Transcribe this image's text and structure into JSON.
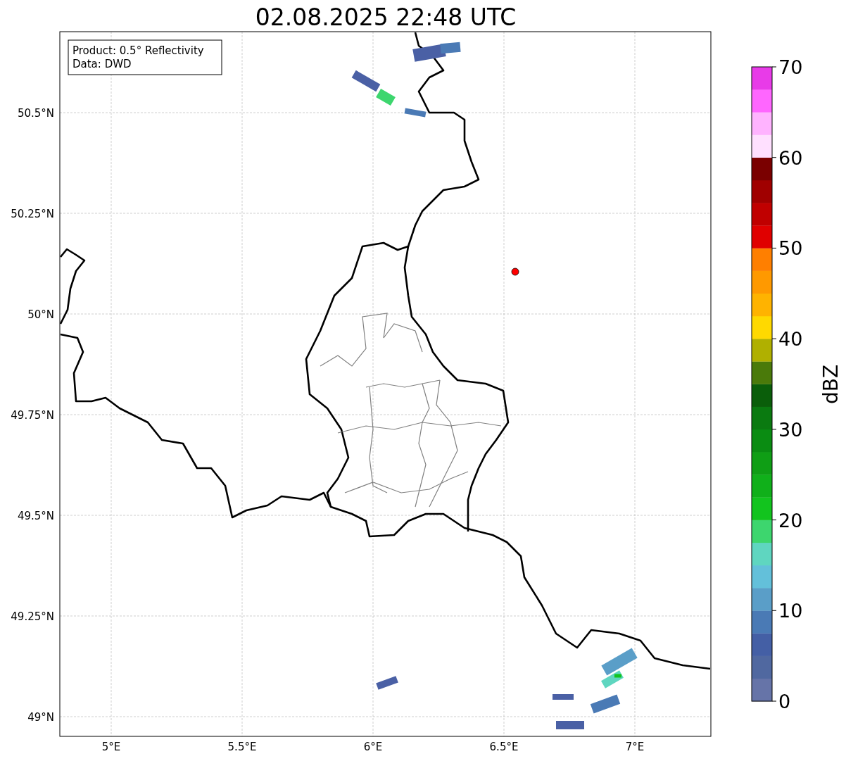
{
  "title": "02.08.2025 22:48 UTC",
  "legend": [
    "Product: 0.5° Reflectivity",
    "Data: DWD"
  ],
  "map": {
    "lat_ticks": [
      "50.5°N",
      "50.25°N",
      "50°N",
      "49.75°N",
      "49.5°N",
      "49.25°N",
      "49°N"
    ],
    "lon_ticks": [
      "5°E",
      "5.5°E",
      "6°E",
      "6.5°E",
      "7°E"
    ]
  },
  "colorbar": {
    "label": "dBZ",
    "ticks": [
      "70",
      "60",
      "50",
      "40",
      "30",
      "20",
      "10",
      "0"
    ],
    "bins": [
      {
        "color": "#6674a8"
      },
      {
        "color": "#5068a0"
      },
      {
        "color": "#445fa5"
      },
      {
        "color": "#4a7ab5"
      },
      {
        "color": "#5a9ec8"
      },
      {
        "color": "#63c0da"
      },
      {
        "color": "#5fd6c0"
      },
      {
        "color": "#3dd66e"
      },
      {
        "color": "#12c41e"
      },
      {
        "color": "#10b01a"
      },
      {
        "color": "#0f9e15"
      },
      {
        "color": "#0a8c12"
      },
      {
        "color": "#0a7a10"
      },
      {
        "color": "#0a5e0a"
      },
      {
        "color": "#4a7a0a"
      },
      {
        "color": "#b0b000"
      },
      {
        "color": "#ffd900"
      },
      {
        "color": "#ffb300"
      },
      {
        "color": "#ff9900"
      },
      {
        "color": "#ff7f00"
      },
      {
        "color": "#e00000"
      },
      {
        "color": "#c00000"
      },
      {
        "color": "#a00000"
      },
      {
        "color": "#7a0000"
      },
      {
        "color": "#ffe0ff"
      },
      {
        "color": "#ffb3ff"
      },
      {
        "color": "#ff66ff"
      },
      {
        "color": "#e83be8"
      }
    ]
  }
}
